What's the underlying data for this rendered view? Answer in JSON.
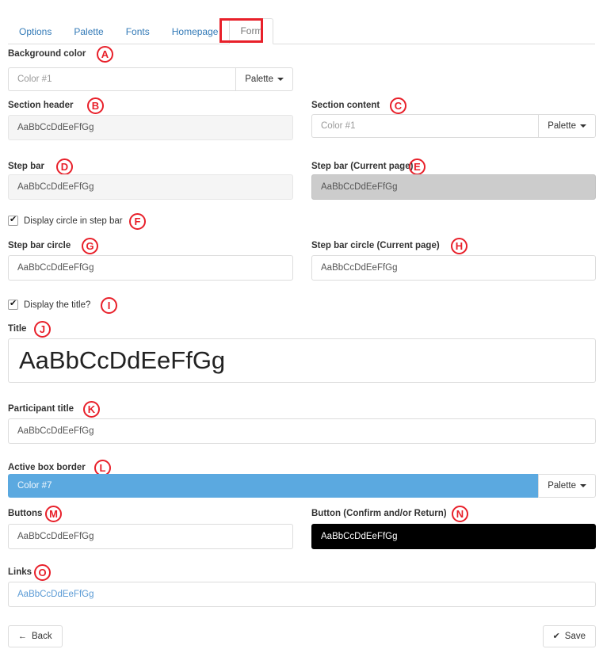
{
  "tabs": [
    {
      "label": "Options",
      "active": false
    },
    {
      "label": "Palette",
      "active": false
    },
    {
      "label": "Fonts",
      "active": false
    },
    {
      "label": "Homepage",
      "active": false
    },
    {
      "label": "Form",
      "active": true
    }
  ],
  "sample_text": "AaBbCcDdEeFfGg",
  "palette_button_label": "Palette",
  "fields": {
    "background_color": {
      "label": "Background color",
      "marker": "A",
      "value": "Color #1",
      "palette_label": "Palette"
    },
    "section_header": {
      "label": "Section header",
      "marker": "B",
      "value": "AaBbCcDdEeFfGg"
    },
    "section_content": {
      "label": "Section content",
      "marker": "C",
      "value": "Color #1",
      "palette_label": "Palette"
    },
    "step_bar": {
      "label": "Step bar",
      "marker": "D",
      "value": "AaBbCcDdEeFfGg"
    },
    "step_bar_current": {
      "label": "Step bar (Current page)",
      "marker": "E",
      "value": "AaBbCcDdEeFfGg"
    },
    "display_circle": {
      "label": "Display circle in step bar",
      "marker": "F",
      "checked": true
    },
    "step_bar_circle": {
      "label": "Step bar circle",
      "marker": "G",
      "value": "AaBbCcDdEeFfGg"
    },
    "step_bar_circle_current": {
      "label": "Step bar circle (Current page)",
      "marker": "H",
      "value": "AaBbCcDdEeFfGg"
    },
    "display_title": {
      "label": "Display the title?",
      "marker": "I",
      "checked": true
    },
    "title": {
      "label": "Title",
      "marker": "J",
      "value": "AaBbCcDdEeFfGg"
    },
    "participant_title": {
      "label": "Participant title",
      "marker": "K",
      "value": "AaBbCcDdEeFfGg"
    },
    "active_box_border": {
      "label": "Active box border",
      "marker": "L",
      "value": "Color #7",
      "palette_label": "Palette"
    },
    "buttons": {
      "label": "Buttons",
      "marker": "M",
      "value": "AaBbCcDdEeFfGg"
    },
    "button_confirm": {
      "label": "Button (Confirm and/or Return)",
      "marker": "N",
      "value": "AaBbCcDdEeFfGg"
    },
    "links": {
      "label": "Links",
      "marker": "O",
      "value": "AaBbCcDdEeFfGg"
    }
  },
  "footer": {
    "back_label": "Back",
    "back_icon": "arrow-left-icon",
    "save_label": "Save",
    "save_icon": "check-icon"
  },
  "colors": {
    "accent_blue": "#5ba9e0",
    "link_blue": "#337ab7",
    "annotation_red": "#e8202a",
    "gray_light": "#f5f5f5",
    "gray_dark": "#cccccc",
    "black": "#000000"
  }
}
